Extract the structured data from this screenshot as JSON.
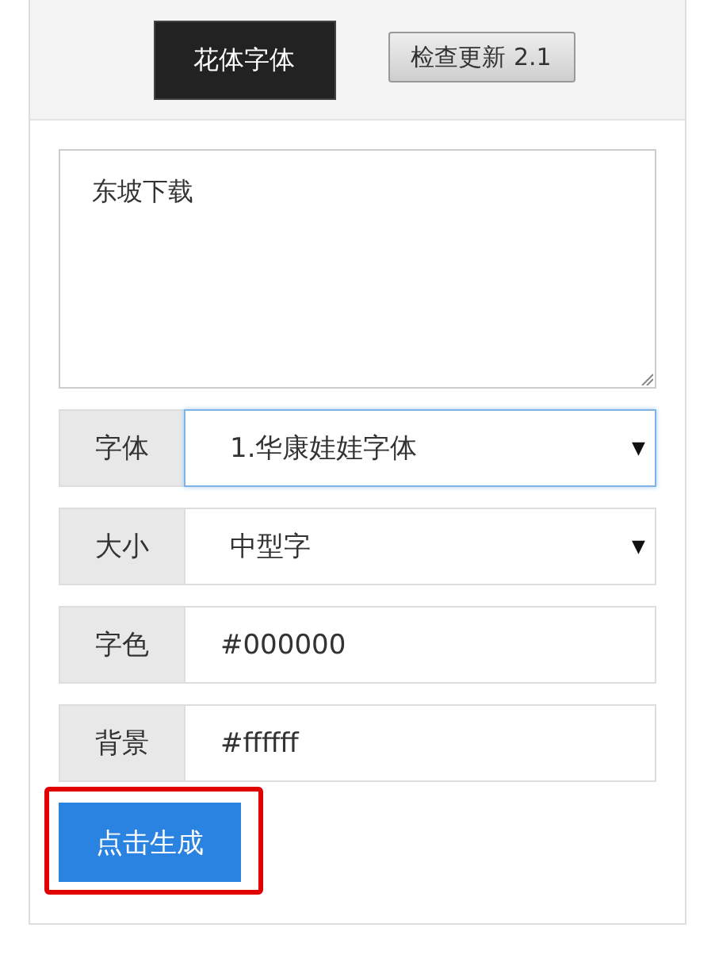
{
  "header": {
    "buttons": [
      {
        "label": "花体字体",
        "kind": "dark"
      },
      {
        "label": "检查更新 2.1",
        "kind": "plain"
      }
    ]
  },
  "text_area": {
    "value": "东坡下载"
  },
  "rows": [
    {
      "label": "字体",
      "kind": "select",
      "value": "1.华康娃娃字体",
      "arrow": "▼",
      "focused": true
    },
    {
      "label": "大小",
      "kind": "select",
      "value": "中型字",
      "arrow": "▼",
      "focused": false
    },
    {
      "label": "字色",
      "kind": "input",
      "value": "#000000",
      "focused": false
    },
    {
      "label": "背景",
      "kind": "input",
      "value": "#ffffff",
      "focused": false
    }
  ],
  "generate_button": {
    "label": "点击生成",
    "highlighted": true
  }
}
